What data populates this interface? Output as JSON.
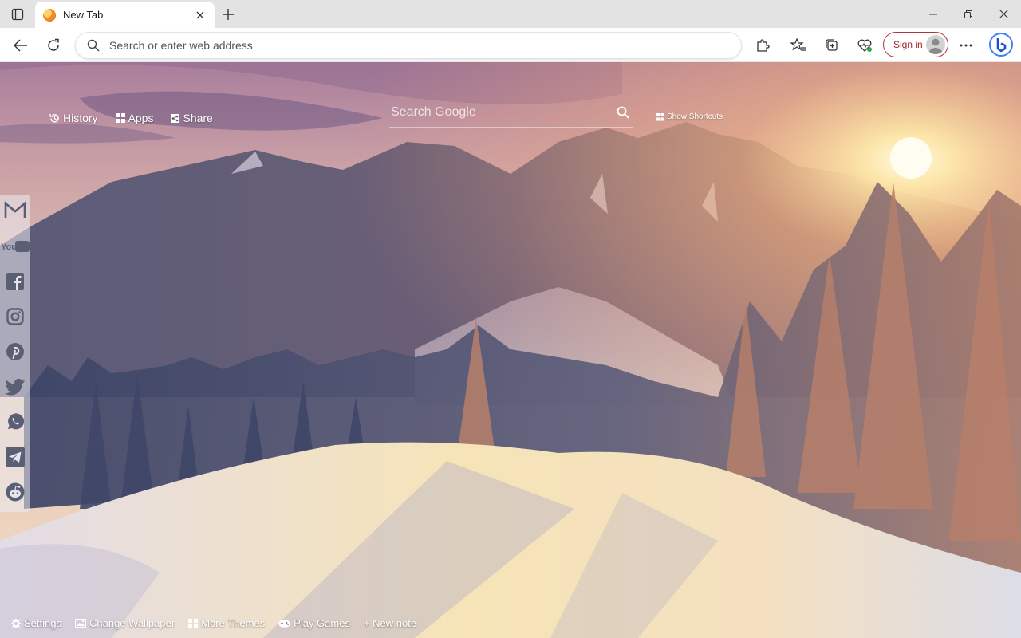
{
  "browser": {
    "tab": {
      "title": "New Tab"
    },
    "address_bar": {
      "placeholder": "Search or enter web address",
      "value": ""
    },
    "sign_in_label": "Sign in"
  },
  "newtab": {
    "top_links": [
      {
        "label": "History",
        "icon": "history-icon"
      },
      {
        "label": "Apps",
        "icon": "apps-grid-icon"
      },
      {
        "label": "Share",
        "icon": "share-icon"
      }
    ],
    "search": {
      "placeholder": "Search Google",
      "value": ""
    },
    "shortcuts_label": "Show Shortcuts",
    "social": [
      {
        "name": "Gmail",
        "icon": "gmail-icon"
      },
      {
        "name": "YouTube",
        "icon": "youtube-icon",
        "label": "YouTube"
      },
      {
        "name": "Facebook",
        "icon": "facebook-icon"
      },
      {
        "name": "Instagram",
        "icon": "instagram-icon"
      },
      {
        "name": "Pinterest",
        "icon": "pinterest-icon"
      },
      {
        "name": "Twitter",
        "icon": "twitter-icon"
      },
      {
        "name": "WhatsApp",
        "icon": "whatsapp-icon"
      },
      {
        "name": "Telegram",
        "icon": "telegram-icon"
      },
      {
        "name": "Reddit",
        "icon": "reddit-icon"
      }
    ],
    "bottom_links": [
      {
        "label": "Settings",
        "icon": "gear-icon"
      },
      {
        "label": "Change Wallpaper",
        "icon": "image-icon"
      },
      {
        "label": "More Themes",
        "icon": "grid-icon"
      },
      {
        "label": "Play Games",
        "icon": "gamepad-icon"
      },
      {
        "label": "+ New note",
        "icon": ""
      }
    ]
  },
  "colors": {
    "signin_border": "#b3343a",
    "sky_top": "#b58aa6",
    "snow": "#f1e6d6",
    "sun": "#fff4c8"
  }
}
